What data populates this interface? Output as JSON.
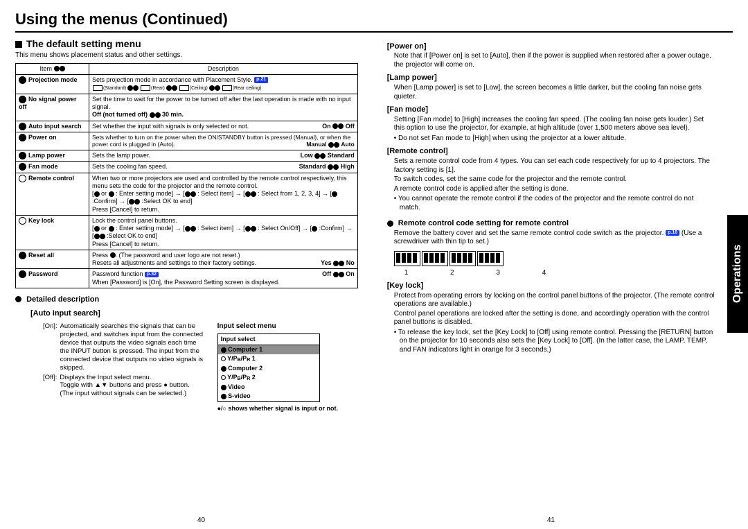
{
  "page_title": "Using the menus (Continued)",
  "section_title": "The default setting menu",
  "intro": "This menu shows placement status and other settings.",
  "table_headers": {
    "item": "Item",
    "desc": "Description"
  },
  "rows": {
    "projection": {
      "label": "Projection mode",
      "desc": "Sets projection mode in accordance with Placement Style.",
      "ref": "p.21",
      "styles": [
        "(Standard)",
        "(Rear)",
        "(Ceiling)",
        "(Rear ceiling)"
      ]
    },
    "nosignal": {
      "label": "No signal power off",
      "desc": "Set the time to wait for the power to be turned off after the last operation is made with no input signal.",
      "extra_off": "Off (not turned off)",
      "extra_30": "30 min."
    },
    "autoinput": {
      "label": "Auto input search",
      "desc": "Set whether the input with signals is only selected or not.",
      "opt_on": "On",
      "opt_off": "Off"
    },
    "poweron": {
      "label": "Power on",
      "desc": "Sets whether to turn on the power when the ON/STANDBY button is pressed (Manual), or when the power cord is plugged in (Auto).",
      "opt_manual": "Manual",
      "opt_auto": "Auto"
    },
    "lamppower": {
      "label": "Lamp power",
      "desc": "Sets the lamp power.",
      "opt_low": "Low",
      "opt_std": "Standard"
    },
    "fanmode": {
      "label": "Fan mode",
      "desc": "Sets the cooling fan speed.",
      "opt_std": "Standard",
      "opt_high": "High"
    },
    "remote": {
      "label": "Remote control",
      "desc1": "When two or more projectors are used and controlled by the remote control respectively, this menu sets the code for the projector and the remote control.",
      "desc2a": "[",
      "desc2b": " or ",
      "desc2c": " : Enter setting mode] → [",
      "desc2d": " : Select item] → [",
      "desc2e": " : Select from 1, 2, 3, 4] → [",
      "desc2f": " :Confirm] → [",
      "desc2g": " :Select OK to end]",
      "desc3": "Press [Cancel] to return."
    },
    "keylock": {
      "label": "Key lock",
      "desc1": "Lock the control panel buttons.",
      "desc2a": "[",
      "desc2b": " or ",
      "desc2c": " : Enter setting mode] → [",
      "desc2d": " : Select item] → [",
      "desc2e": " : Select On/Off] → [",
      "desc2f": " :Confirm] → [",
      "desc2g": " :Select OK to end]",
      "desc3": "Press [Cancel] to return."
    },
    "resetall": {
      "label": "Reset all",
      "desc1": "Press ",
      "desc1b": ". (The password and user logo are not reset.)",
      "desc2": "Resets all adjustments and settings to their factory settings.",
      "opt_yes": "Yes",
      "opt_no": "No"
    },
    "password": {
      "label": "Password",
      "desc1": "Password function ",
      "ref": "p.32",
      "desc2": "When [Password] is [On], the Password Setting screen is displayed.",
      "opt_off": "Off",
      "opt_on": "On"
    }
  },
  "detailed": {
    "head": "Detailed description",
    "auto_head": "[Auto input search]",
    "on_lab": "[On]:",
    "on_txt": "Automatically searches the signals that can be projected, and switches input from the connected device that outputs the video signals each time the INPUT button is pressed. The input from the connected device that outputs no video signals is skipped.",
    "off_lab": "[Off]:",
    "off_txt": "Displays the Input select menu.",
    "off_txt2": "Toggle with ▲▼ buttons and press ● button. (The input without signals can be selected.)",
    "menu_title": "Input select menu",
    "menu_head": "Input select",
    "items": [
      "Computer 1",
      "Y/PB/PR 1",
      "Computer 2",
      "Y/PB/PR 2",
      "Video",
      "S-video"
    ],
    "footnote": "●/○ shows whether signal is input or not."
  },
  "right": {
    "poweron_h": "[Power on]",
    "poweron_t": "Note that if [Power on] is set to [Auto], then if the power is supplied when restored after a power outage, the projector will come on.",
    "lamp_h": "[Lamp power]",
    "lamp_t": "When [Lamp power] is set to [Low], the screen becomes a little darker, but the cooling fan noise gets quieter.",
    "fan_h": "[Fan mode]",
    "fan_t": "Setting [Fan mode] to [High] increases the cooling fan speed. (The cooling fan noise gets louder.) Set this option to use the projector, for example, at high altitude (over 1,500 meters above sea level).",
    "fan_b": "Do not set Fan mode to [High] when using the projector at a lower altitude.",
    "rc_h": "[Remote control]",
    "rc_t1": "Sets a remote control code from 4 types. You can set each code respectively for up to 4 projectors. The factory setting is [1].",
    "rc_t2": "To switch codes, set the same code for the projector and the remote control.",
    "rc_t3": "A remote control code is applied after the setting is done.",
    "rc_b": "You cannot operate the remote control if the codes of the projector and the remote control do not match.",
    "rcset_h": "Remote control code setting for remote control",
    "rcset_t1": "Remove the battery cover and set the same remote control code switch as the projector.",
    "rcset_ref": "p.16",
    "rcset_t2": " (Use a screwdriver with thin tip to set.)",
    "dip_labels": "1  2  3  4",
    "key_h": "[Key lock]",
    "key_t1": "Protect from operating errors by locking on the control panel buttons of the projector. (The remote control operations are available.)",
    "key_t2": "Control panel operations are locked after the setting is done, and accordingly operation with the control panel buttons is disabled.",
    "key_b": "To release the key lock, set the [Key Lock] to [Off] using remote control. Pressing the [RETURN] button on the projector for 10 seconds also sets the [Key Lock] to [Off]. (In the latter case, the LAMP, TEMP, and FAN indicators light in orange for 3 seconds.)"
  },
  "sidetab": "Operations",
  "page_left": "40",
  "page_right": "41"
}
